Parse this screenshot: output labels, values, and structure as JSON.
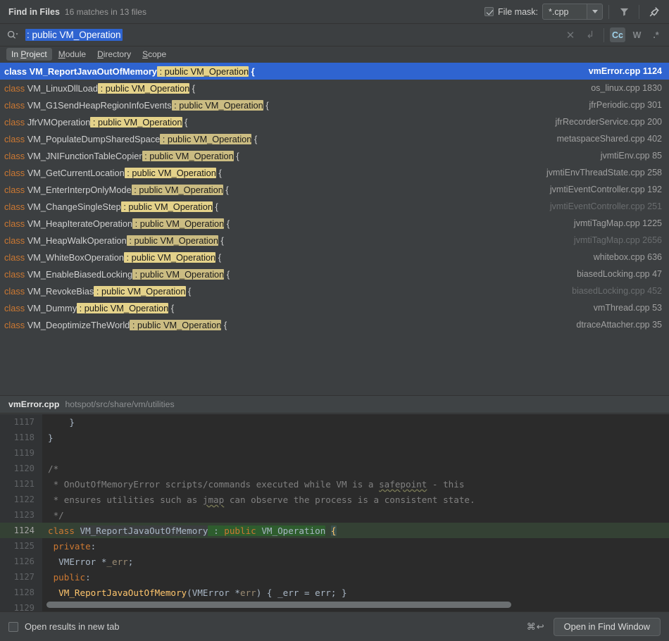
{
  "header": {
    "title": "Find in Files",
    "summary": "16 matches in 13 files",
    "file_mask_label": "File mask:",
    "file_mask_value": "*.cpp",
    "file_mask_checked": true,
    "filter_icon": "filter-funnel-icon",
    "pin_icon": "pin-icon"
  },
  "search": {
    "query": ": public VM_Operation",
    "search_icon": "search-icon",
    "clear_icon": "close-icon",
    "new_line_icon": "return-arrow-icon",
    "toggles": [
      {
        "name": "match-case",
        "label": "Cc",
        "active": true
      },
      {
        "name": "words",
        "label": "W",
        "active": false
      },
      {
        "name": "regex",
        "label": ".*",
        "active": false
      }
    ]
  },
  "scopes": [
    {
      "label": "In Project",
      "mnemonic": "P",
      "active": true
    },
    {
      "label": "Module",
      "mnemonic": "M",
      "active": false
    },
    {
      "label": "Directory",
      "mnemonic": "D",
      "active": false
    },
    {
      "label": "Scope",
      "mnemonic": "S",
      "active": false
    }
  ],
  "results": [
    {
      "keyword": "class ",
      "name": "VM_ReportJavaOutOfMemory",
      "match": " : public VM_Operation",
      "tail": " {",
      "file": "vmError.cpp",
      "line": "1124",
      "selected": true,
      "dim_file": false,
      "dim_match": false
    },
    {
      "keyword": "class ",
      "name": "VM_LinuxDllLoad",
      "match": " : public VM_Operation",
      "tail": " {",
      "file": "os_linux.cpp",
      "line": "1830",
      "selected": false,
      "dim_file": false,
      "dim_match": false
    },
    {
      "keyword": "class ",
      "name": "VM_G1SendHeapRegionInfoEvents",
      "match": " : public VM_Operation",
      "tail": " {",
      "file": "jfrPeriodic.cpp",
      "line": "301",
      "selected": false,
      "dim_file": false,
      "dim_match": true
    },
    {
      "keyword": "class ",
      "name": "JfrVMOperation",
      "match": " : public VM_Operation",
      "tail": " {",
      "file": "jfrRecorderService.cpp",
      "line": "200",
      "selected": false,
      "dim_file": false,
      "dim_match": false
    },
    {
      "keyword": "class ",
      "name": "VM_PopulateDumpSharedSpace",
      "match": " : public VM_Operation",
      "tail": " {",
      "file": "metaspaceShared.cpp",
      "line": "402",
      "selected": false,
      "dim_file": false,
      "dim_match": true
    },
    {
      "keyword": "class ",
      "name": "VM_JNIFunctionTableCopier",
      "match": " : public VM_Operation",
      "tail": " {",
      "file": "jvmtiEnv.cpp",
      "line": "85",
      "selected": false,
      "dim_file": false,
      "dim_match": true
    },
    {
      "keyword": "class ",
      "name": "VM_GetCurrentLocation",
      "match": " : public VM_Operation",
      "tail": " {",
      "file": "jvmtiEnvThreadState.cpp",
      "line": "258",
      "selected": false,
      "dim_file": false,
      "dim_match": false
    },
    {
      "keyword": "class ",
      "name": "VM_EnterInterpOnlyMode",
      "match": " : public VM_Operation",
      "tail": " {",
      "file": "jvmtiEventController.cpp",
      "line": "192",
      "selected": false,
      "dim_file": false,
      "dim_match": true
    },
    {
      "keyword": "class ",
      "name": "VM_ChangeSingleStep",
      "match": " : public VM_Operation",
      "tail": " {",
      "file": "jvmtiEventController.cpp",
      "line": "251",
      "selected": false,
      "dim_file": true,
      "dim_match": false
    },
    {
      "keyword": "class ",
      "name": "VM_HeapIterateOperation",
      "match": " : public VM_Operation",
      "tail": " {",
      "file": "jvmtiTagMap.cpp",
      "line": "1225",
      "selected": false,
      "dim_file": false,
      "dim_match": true
    },
    {
      "keyword": "class ",
      "name": "VM_HeapWalkOperation",
      "match": " : public VM_Operation",
      "tail": " {",
      "file": "jvmtiTagMap.cpp",
      "line": "2656",
      "selected": false,
      "dim_file": true,
      "dim_match": true
    },
    {
      "keyword": "class ",
      "name": "VM_WhiteBoxOperation",
      "match": " : public VM_Operation",
      "tail": " {",
      "file": "whitebox.cpp",
      "line": "636",
      "selected": false,
      "dim_file": false,
      "dim_match": false
    },
    {
      "keyword": "class ",
      "name": "VM_EnableBiasedLocking",
      "match": " : public VM_Operation",
      "tail": " {",
      "file": "biasedLocking.cpp",
      "line": "47",
      "selected": false,
      "dim_file": false,
      "dim_match": true
    },
    {
      "keyword": "class ",
      "name": "VM_RevokeBias",
      "match": " : public VM_Operation",
      "tail": " {",
      "file": "biasedLocking.cpp",
      "line": "452",
      "selected": false,
      "dim_file": true,
      "dim_match": false
    },
    {
      "keyword": "class ",
      "name": "VM_Dummy",
      "match": " : public VM_Operation",
      "tail": " {",
      "file": "vmThread.cpp",
      "line": "53",
      "selected": false,
      "dim_file": false,
      "dim_match": false
    },
    {
      "keyword": "class ",
      "name": "VM_DeoptimizeTheWorld",
      "match": " : public VM_Operation",
      "tail": " {",
      "file": "dtraceAttacher.cpp",
      "line": "35",
      "selected": false,
      "dim_file": false,
      "dim_match": true
    }
  ],
  "preview": {
    "file": "vmError.cpp",
    "path": "hotspot/src/share/vm/utilities",
    "lines": [
      {
        "num": "1117",
        "highlight": false,
        "segments": [
          {
            "text": "    }",
            "cls": "c-id"
          }
        ]
      },
      {
        "num": "1118",
        "highlight": false,
        "segments": [
          {
            "text": "}",
            "cls": "c-id"
          }
        ]
      },
      {
        "num": "1119",
        "highlight": false,
        "segments": [
          {
            "text": "",
            "cls": "c-id"
          }
        ]
      },
      {
        "num": "1120",
        "highlight": false,
        "segments": [
          {
            "text": "/*",
            "cls": "c-cmt"
          }
        ]
      },
      {
        "num": "1121",
        "highlight": false,
        "segments": [
          {
            "text": " * OnOutOfMemoryError scripts/commands executed while VM is a ",
            "cls": "c-cmt"
          },
          {
            "text": "safepoint",
            "cls": "c-cmt squiggle"
          },
          {
            "text": " - this",
            "cls": "c-cmt"
          }
        ]
      },
      {
        "num": "1122",
        "highlight": false,
        "segments": [
          {
            "text": " * ensures utilities such as ",
            "cls": "c-cmt"
          },
          {
            "text": "jmap",
            "cls": "c-cmt squiggle"
          },
          {
            "text": " can observe the process is a consistent state.",
            "cls": "c-cmt"
          }
        ]
      },
      {
        "num": "1123",
        "highlight": false,
        "segments": [
          {
            "text": " */",
            "cls": "c-cmt"
          }
        ]
      },
      {
        "num": "1124",
        "highlight": true,
        "segments": [
          {
            "text": "class ",
            "cls": "c-kw"
          },
          {
            "text": "VM_ReportJavaOutOfMemory",
            "cls": "c-id ident-bg"
          },
          {
            "text": " : ",
            "cls": "c-id match-bg"
          },
          {
            "text": "public",
            "cls": "c-kw match-bg"
          },
          {
            "text": " VM_Operation",
            "cls": "c-id match-bg"
          },
          {
            "text": " ",
            "cls": "c-id"
          },
          {
            "text": "{",
            "cls": "brace-bg"
          }
        ]
      },
      {
        "num": "1125",
        "highlight": false,
        "segments": [
          {
            "text": " private",
            "cls": "c-kw"
          },
          {
            "text": ":",
            "cls": "c-id"
          }
        ]
      },
      {
        "num": "1126",
        "highlight": false,
        "segments": [
          {
            "text": "  VMError *",
            "cls": "c-id"
          },
          {
            "text": "_err",
            "cls": "c-par"
          },
          {
            "text": ";",
            "cls": "c-id"
          }
        ]
      },
      {
        "num": "1127",
        "highlight": false,
        "segments": [
          {
            "text": " public",
            "cls": "c-kw"
          },
          {
            "text": ":",
            "cls": "c-id"
          }
        ]
      },
      {
        "num": "1128",
        "highlight": false,
        "segments": [
          {
            "text": "  ",
            "cls": "c-id"
          },
          {
            "text": "VM_ReportJavaOutOfMemory",
            "cls": "c-fn"
          },
          {
            "text": "(VMError *",
            "cls": "c-id"
          },
          {
            "text": "err",
            "cls": "c-par"
          },
          {
            "text": ") { _err = err; }",
            "cls": "c-id"
          }
        ]
      },
      {
        "num": "1129",
        "highlight": false,
        "segments": [
          {
            "text": "",
            "cls": "c-id"
          }
        ]
      }
    ]
  },
  "footer": {
    "open_new_tab_label": "Open results in new tab",
    "open_new_tab_checked": false,
    "shortcut": "⌘↩",
    "button_label": "Open in Find Window"
  }
}
